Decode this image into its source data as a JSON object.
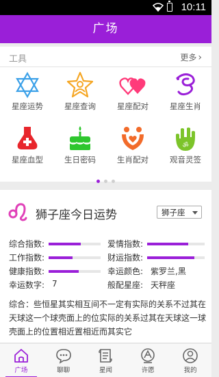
{
  "status_bar": {
    "time": "10:11"
  },
  "app_bar": {
    "title": "广场"
  },
  "tools": {
    "section_label": "工具",
    "more_label": "更多",
    "items": [
      {
        "label": "星座运势",
        "icon": "star-of-david-icon",
        "color": "#3aa0e8"
      },
      {
        "label": "星座查询",
        "icon": "star-person-icon",
        "color": "#f5a623"
      },
      {
        "label": "星座配对",
        "icon": "two-hearts-icon",
        "color": "#ff3b7a"
      },
      {
        "label": "星座生肖",
        "icon": "zodiac-snake-icon",
        "color": "#9a1fd8"
      },
      {
        "label": "星座血型",
        "icon": "blood-bottle-icon",
        "color": "#e8262c"
      },
      {
        "label": "生日密码",
        "icon": "birthday-cake-icon",
        "color": "#2ec62e"
      },
      {
        "label": "生肖配对",
        "icon": "couple-heart-icon",
        "color": "#f26b2a"
      },
      {
        "label": "观音灵签",
        "icon": "hand-om-icon",
        "color": "#7cc42a"
      }
    ],
    "page_indicator": {
      "pages": 3,
      "current": 1
    }
  },
  "fortune": {
    "title": "狮子座今日运势",
    "sign_select": "狮子座",
    "accent_color": "#9a1fd8",
    "ratings": [
      {
        "label": "综合指数:",
        "level": 0.62
      },
      {
        "label": "爱情指数:",
        "level": 0.72
      },
      {
        "label": "工作指数:",
        "level": 0.46
      },
      {
        "label": "财运指数:",
        "level": 0.82
      },
      {
        "label": "健康指数:",
        "level": 0.58
      }
    ],
    "lucky_color_label": "幸运颜色:",
    "lucky_color_value": "紫罗兰,黑",
    "lucky_number_label": "幸运数字:",
    "lucky_number_value": "7",
    "match_label": "般配星座:",
    "match_value": "天秤座",
    "summary": "综合：些恒星其实相互间不一定有实际的关系不过其在天球这一个球壳面上的位实际的关系过其在天球这一球壳面上的位置相近置相近而其实它"
  },
  "tab_bar": {
    "items": [
      {
        "label": "广场",
        "icon": "home-icon",
        "active": true
      },
      {
        "label": "聊聊",
        "icon": "chat-bubble-icon",
        "active": false
      },
      {
        "label": "星闻",
        "icon": "news-scroll-icon",
        "active": false
      },
      {
        "label": "许愿",
        "icon": "wish-cone-icon",
        "active": false
      },
      {
        "label": "我的",
        "icon": "profile-icon",
        "active": false
      }
    ]
  }
}
